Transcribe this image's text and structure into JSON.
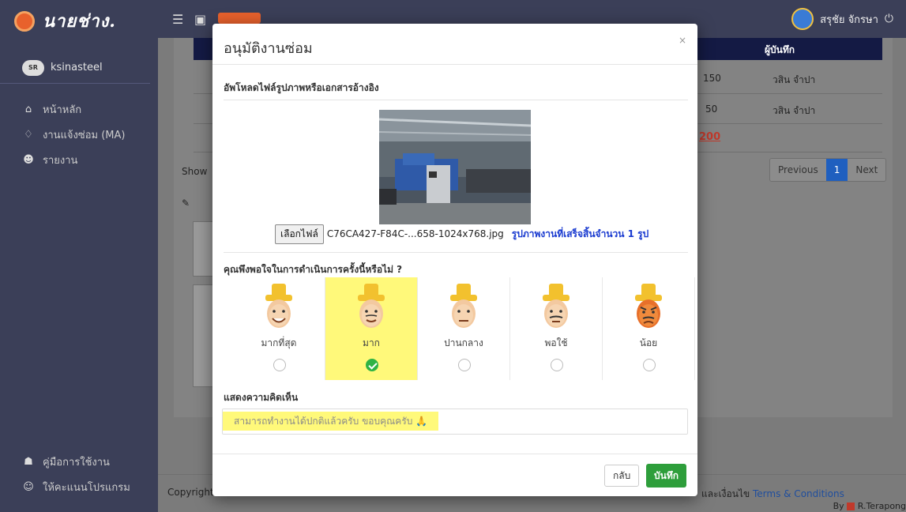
{
  "app": {
    "logo_text": "นายช่าง.",
    "user_name": "สรุชัย จักรษา"
  },
  "sidebar": {
    "username": "ksinasteel",
    "avatar_text": "SR",
    "items": [
      {
        "label": "หน้าหลัก",
        "icon": "home-icon"
      },
      {
        "label": "งานแจ้งซ่อม (MA)",
        "icon": "bell-icon"
      },
      {
        "label": "รายงาน",
        "icon": "users-icon"
      }
    ],
    "bottom_items": [
      {
        "label": "คู่มือการใช้งาน",
        "icon": "manual-icon"
      },
      {
        "label": "ให้คะแนนโปรแกรม",
        "icon": "smile-icon"
      }
    ]
  },
  "background": {
    "table_header": "ผู้บันทึก",
    "rows": [
      {
        "amount": "150",
        "recorder": "วสิน จำปา"
      },
      {
        "amount": "50",
        "recorder": "วสิน จำปา"
      }
    ],
    "total": "200",
    "show_text": "Show",
    "pager": {
      "previous": "Previous",
      "page": "1",
      "next": "Next"
    },
    "footer_left": "Copyright",
    "footer_terms_prefix": "และเงื่อนไข",
    "footer_terms_link": "Terms & Conditions",
    "footer_by": "By",
    "footer_author": "R.Terapong"
  },
  "modal": {
    "title": "อนุมัติงานซ่อม",
    "close": "×",
    "upload_label": "อัพโหลดไฟล์รูปภาพหรือเอกสารอ้างอิง",
    "file_button": "เลือกไฟล์",
    "file_name": "C76CA427-F84C-...658-1024x768.jpg",
    "file_status": "รูปภาพงานที่เสร็จสิ้นจำนวน 1 รูป",
    "question": "คุณพึงพอใจในการดำเนินการครั้งนี้หรือไม่ ?",
    "ratings": [
      {
        "label": "มากที่สุด",
        "selected": false
      },
      {
        "label": "มาก",
        "selected": true
      },
      {
        "label": "ปานกลาง",
        "selected": false
      },
      {
        "label": "พอใช้",
        "selected": false
      },
      {
        "label": "น้อย",
        "selected": false
      }
    ],
    "comment_label": "แสดงความคิดเห็น",
    "comment_value": "สามารถทำงานได้ปกติแล้วครับ ขอบคุณครับ 🙏",
    "back_button": "กลับ",
    "save_button": "บันทึก"
  },
  "colors": {
    "sidebar_bg": "#3b3f58",
    "table_header_bg": "#141a44",
    "highlight": "#fff97a",
    "save_green": "#2e9e3b",
    "link_blue": "#1a3bd0"
  }
}
